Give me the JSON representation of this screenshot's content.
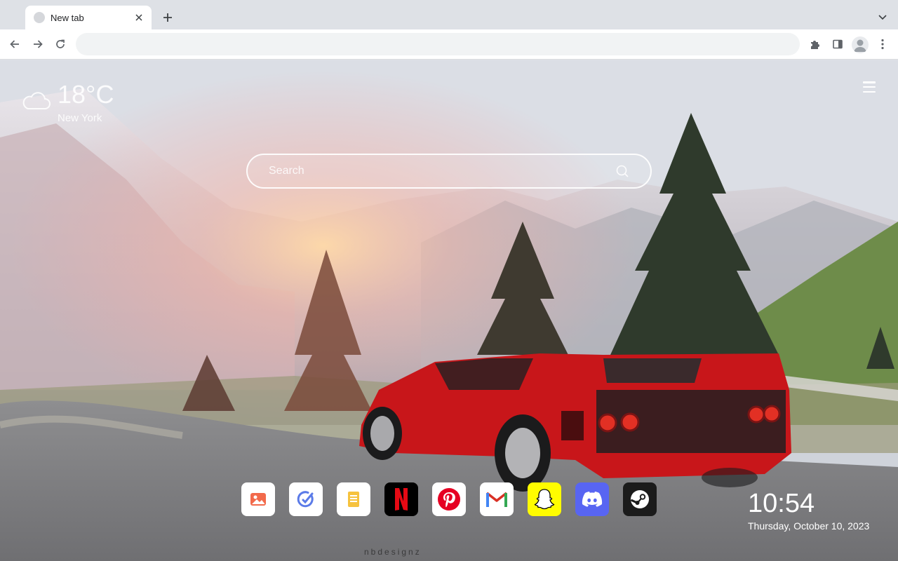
{
  "browser": {
    "tab": {
      "title": "New tab"
    },
    "omnibox": {
      "value": "",
      "placeholder": ""
    }
  },
  "newtab": {
    "weather": {
      "temperature": "18°C",
      "city": "New York",
      "icon": "cloud-icon"
    },
    "search": {
      "placeholder": "Search"
    },
    "apps": [
      {
        "name": "photos",
        "icon": "image-icon",
        "bg": "#ffffff"
      },
      {
        "name": "tasks",
        "icon": "check-circle-icon",
        "bg": "#ffffff"
      },
      {
        "name": "notes",
        "icon": "note-icon",
        "bg": "#ffffff"
      },
      {
        "name": "netflix",
        "icon": "netflix-icon",
        "bg": "#000000"
      },
      {
        "name": "pinterest",
        "icon": "pinterest-icon",
        "bg": "#ffffff"
      },
      {
        "name": "gmail",
        "icon": "gmail-icon",
        "bg": "#ffffff"
      },
      {
        "name": "snapchat",
        "icon": "snapchat-icon",
        "bg": "#fffc00"
      },
      {
        "name": "discord",
        "icon": "discord-icon",
        "bg": "#5865f2"
      },
      {
        "name": "steam",
        "icon": "steam-icon",
        "bg": "#1b1b1b"
      }
    ],
    "clock": {
      "time": "10:54",
      "date": "Thursday, October 10, 2023"
    },
    "watermark": "nbdesignz"
  },
  "colors": {
    "accent_red": "#d4191b",
    "chrome_bg": "#dee1e6"
  }
}
